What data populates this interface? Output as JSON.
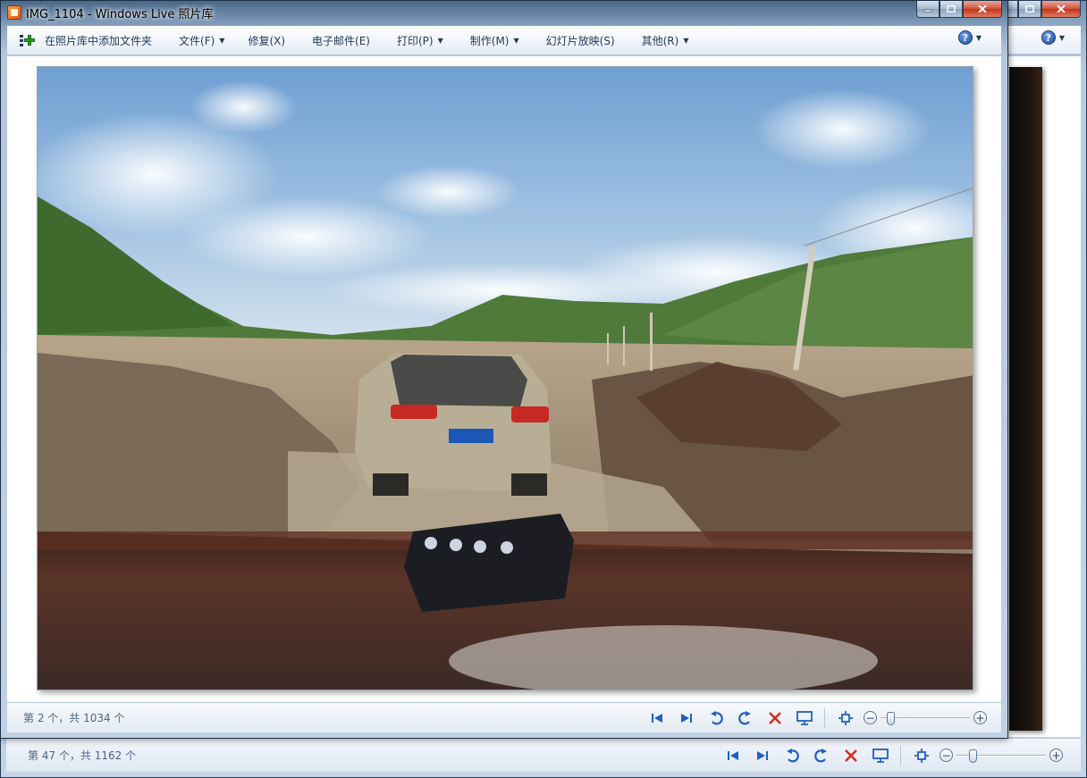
{
  "background_window": {
    "caption_buttons": [
      "minimize",
      "maximize",
      "close"
    ],
    "help_label": "?",
    "status": {
      "counter_text": "第 47 个，共 1162 个"
    }
  },
  "window": {
    "title": "IMG_1104 - Windows Live 照片库",
    "caption_buttons": [
      "minimize",
      "maximize",
      "close"
    ]
  },
  "menubar": {
    "add_folder_label": "在照片库中添加文件夹",
    "items": [
      {
        "label": "文件(F)",
        "has_dropdown": true
      },
      {
        "label": "修复(X)",
        "has_dropdown": false
      },
      {
        "label": "电子邮件(E)",
        "has_dropdown": false
      },
      {
        "label": "打印(P)",
        "has_dropdown": true
      },
      {
        "label": "制作(M)",
        "has_dropdown": true
      },
      {
        "label": "幻灯片放映(S)",
        "has_dropdown": false
      },
      {
        "label": "其他(R)",
        "has_dropdown": true
      }
    ],
    "help_label": "?"
  },
  "photo": {
    "name": "IMG_1104"
  },
  "statusbar": {
    "counter_text": "第 2 个，共 1034 个",
    "zoom_level": 0.08,
    "controls": [
      "previous-icon",
      "next-icon",
      "rotate-left-icon",
      "rotate-right-icon",
      "delete-icon",
      "slideshow-icon",
      "fit-icon"
    ]
  },
  "colors": {
    "accent": "#1e395b",
    "control_blue": "#1f5fbf",
    "delete_red": "#d42a1c"
  }
}
